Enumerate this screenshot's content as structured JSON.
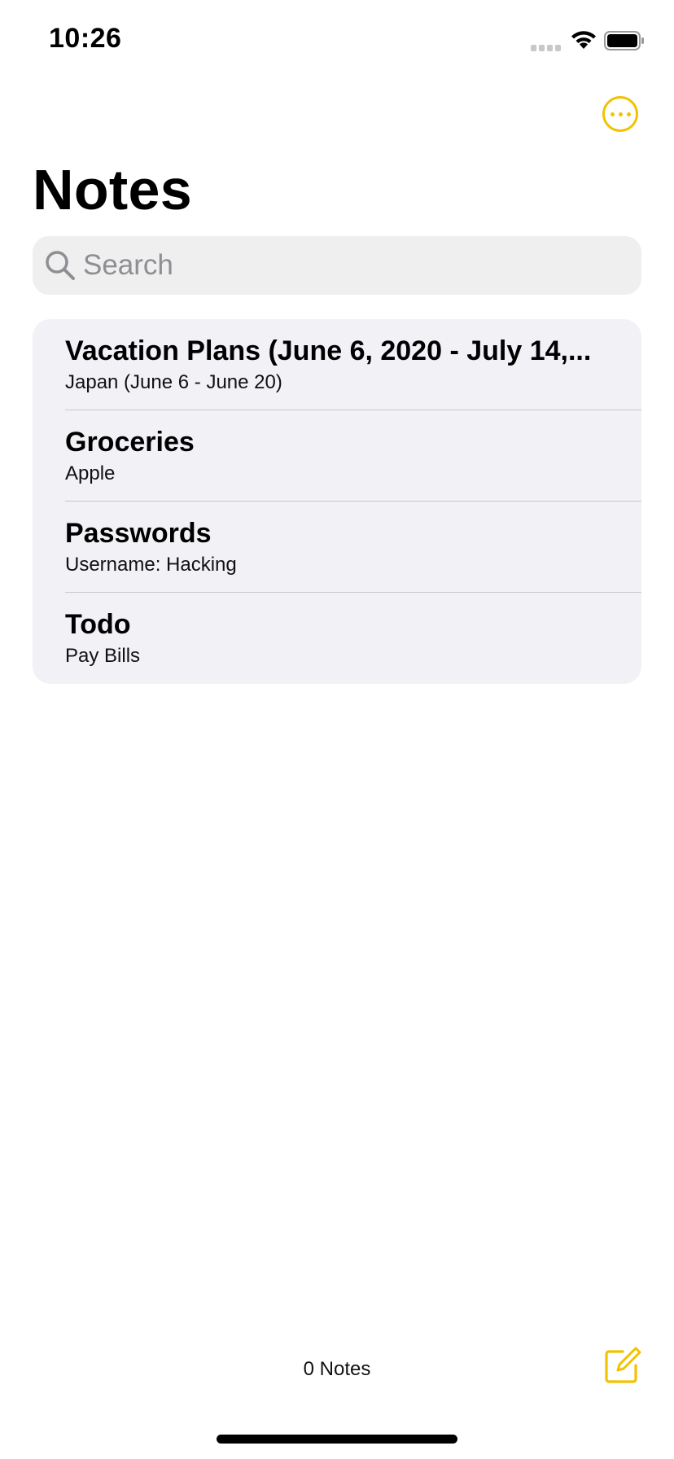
{
  "status_bar": {
    "time": "10:26",
    "icons": [
      "cellular-signal-icon",
      "wifi-icon",
      "battery-icon"
    ]
  },
  "nav": {
    "more_icon": "ellipsis-circle-icon",
    "title": "Notes"
  },
  "search": {
    "placeholder": "Search",
    "value": "",
    "icon": "magnifying-glass-icon"
  },
  "notes": [
    {
      "title": "Vacation Plans (June 6, 2020 - July 14,...",
      "preview": "Japan (June 6 - June 20)"
    },
    {
      "title": "Groceries",
      "preview": "Apple"
    },
    {
      "title": "Passwords",
      "preview": "Username: Hacking"
    },
    {
      "title": "Todo",
      "preview": "Pay Bills"
    }
  ],
  "toolbar": {
    "note_count": "0 Notes",
    "compose_icon": "compose-icon"
  },
  "colors": {
    "accent": "#f2c200",
    "list_background": "#f1f1f6",
    "search_background": "#efeff0",
    "placeholder": "#8e8e93"
  }
}
